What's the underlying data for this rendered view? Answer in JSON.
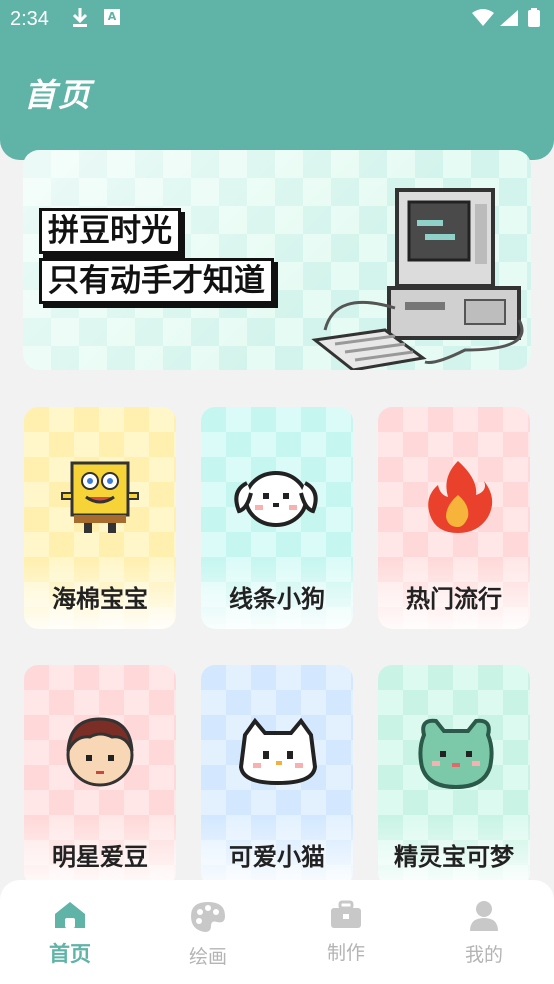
{
  "status": {
    "time": "2:34",
    "app_badge": "A"
  },
  "page": {
    "title": "首页"
  },
  "banner": {
    "line1": "拼豆时光",
    "line2": "只有动手才知道"
  },
  "categories": [
    {
      "label": "海棉宝宝",
      "icon": "sponge-character-icon"
    },
    {
      "label": "线条小狗",
      "icon": "line-dog-icon"
    },
    {
      "label": "热门流行",
      "icon": "fire-icon"
    },
    {
      "label": "明星爱豆",
      "icon": "idol-face-icon"
    },
    {
      "label": "可爱小猫",
      "icon": "cute-cat-icon"
    },
    {
      "label": "精灵宝可梦",
      "icon": "pokemon-icon"
    }
  ],
  "nav": [
    {
      "label": "首页",
      "icon": "home-icon",
      "active": true
    },
    {
      "label": "绘画",
      "icon": "palette-icon"
    },
    {
      "label": "制作",
      "icon": "briefcase-icon"
    },
    {
      "label": "我的",
      "icon": "profile-icon"
    }
  ],
  "colors": {
    "primary": "#5fb3a7",
    "inactive": "#b4b4b4"
  }
}
